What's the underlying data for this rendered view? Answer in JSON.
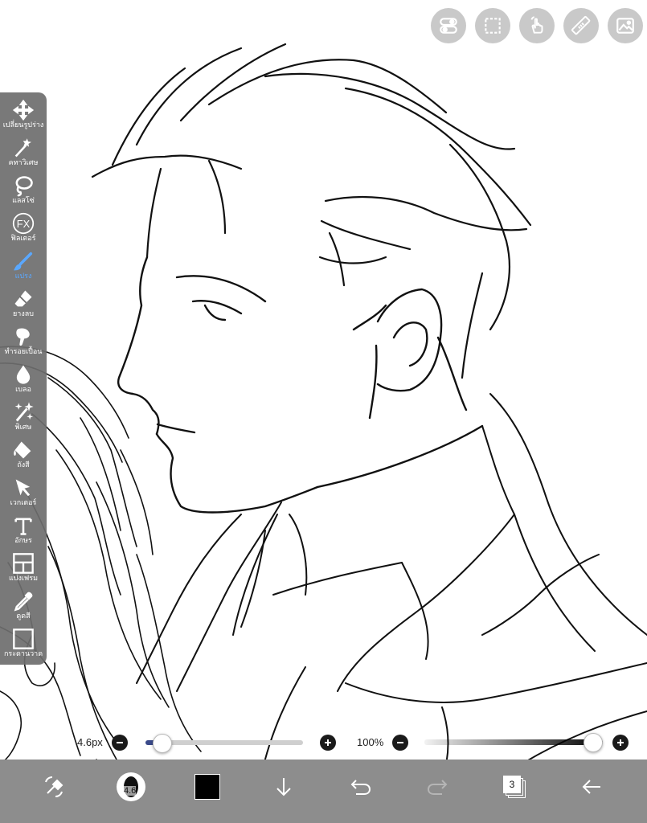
{
  "toolbar": {
    "tools": [
      {
        "label": "เปลี่ยนรูปร่าง",
        "icon": "move-icon"
      },
      {
        "label": "คทาวิเศษ",
        "icon": "magic-wand-icon"
      },
      {
        "label": "แลสโซ่",
        "icon": "lasso-icon"
      },
      {
        "label": "ฟิลเตอร์",
        "icon": "fx-icon"
      },
      {
        "label": "แปรง",
        "icon": "brush-icon"
      },
      {
        "label": "ยางลบ",
        "icon": "eraser-icon"
      },
      {
        "label": "ทำรอยเปื้อน",
        "icon": "smudge-icon"
      },
      {
        "label": "เบลอ",
        "icon": "blur-drop-icon"
      },
      {
        "label": "พิเศษ",
        "icon": "special-sparkle-icon"
      },
      {
        "label": "ถังสี",
        "icon": "fill-bucket-icon"
      },
      {
        "label": "เวกเตอร์",
        "icon": "vector-cursor-icon"
      },
      {
        "label": "อักษร",
        "icon": "text-icon"
      },
      {
        "label": "แบ่งเฟรม",
        "icon": "frame-divider-icon"
      },
      {
        "label": "ดูดสี",
        "icon": "eyedropper-icon"
      },
      {
        "label": "กระดานวาด",
        "icon": "canvas-icon"
      }
    ],
    "active_tool": "แปรง"
  },
  "top_buttons": [
    "toggle-icon",
    "selection-icon",
    "gesture-icon",
    "ruler-icon",
    "gallery-icon"
  ],
  "brush_size": {
    "label": "4.6px",
    "value": 4.6
  },
  "opacity": {
    "label": "100%",
    "value": 100
  },
  "bottom_bar": {
    "brush_badge": "4.6",
    "layer_count": "3",
    "current_color": "#000000"
  },
  "colors": {
    "panel": "#6e6e6e",
    "active": "#5aa8ff",
    "bottom_bar": "#8d8d8d"
  }
}
